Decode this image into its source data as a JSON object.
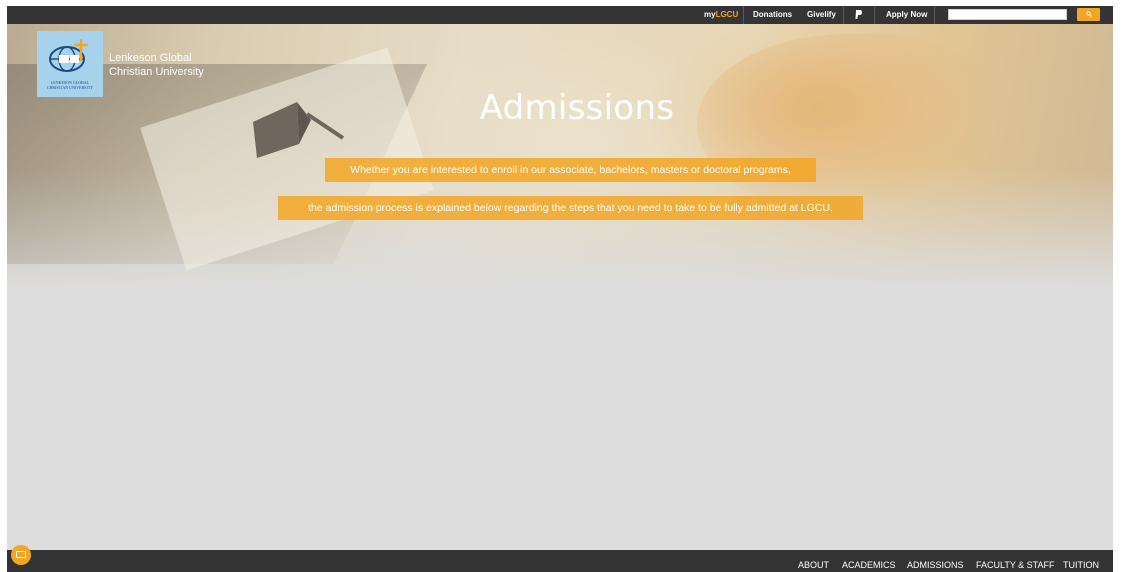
{
  "topbar": {
    "my_prefix": "my",
    "my_accent": "LGCU",
    "donations": "Donations",
    "givelify": "Givelify",
    "paypal_icon": "paypal-icon",
    "apply_now": "Apply Now",
    "search_placeholder": "",
    "search_button_icon": "search-icon"
  },
  "logo": {
    "caption_line1": "LENKESON GLOBAL",
    "caption_line2": "CHRISTIAN UNIVERSITY",
    "name_line1": "Lenkeson Global",
    "name_line2": "Christian University"
  },
  "hero": {
    "title": "Admissions",
    "line1": "Whether you are interested to enroll in our associate, bachelors, masters or doctoral programs,",
    "line2": "the admission process is explained below regarding the steps that you need to take to be fully admitted at LGCU."
  },
  "bottomnav": {
    "items": [
      "ABOUT",
      "ACADEMICS",
      "ADMISSIONS",
      "FACULTY & STAFF",
      "TUITION"
    ]
  },
  "colors": {
    "accent": "#f2a623",
    "bar": "#343434",
    "background": "#dcdcdc"
  }
}
